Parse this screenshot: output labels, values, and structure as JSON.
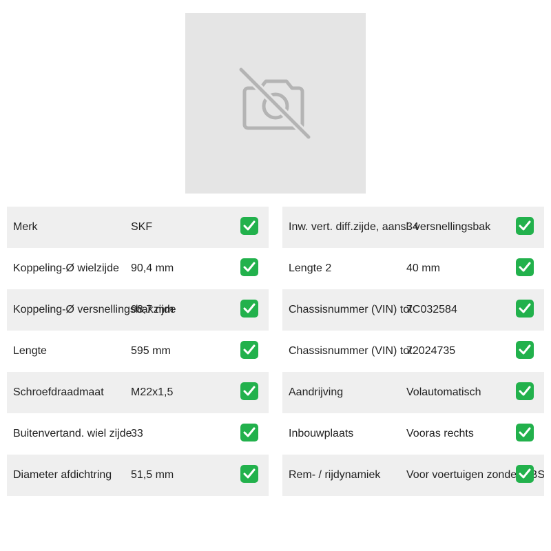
{
  "product_image": {
    "icon": "no-photo-icon",
    "background": "#e5e5e5"
  },
  "check_icon": {
    "name": "check-mark-icon",
    "color": "#22b14c"
  },
  "specs_left": [
    {
      "label": "Merk",
      "value": "SKF"
    },
    {
      "label": "Koppeling-Ø wielzijde",
      "value": "90,4 mm"
    },
    {
      "label": "Koppeling-Ø versnellingsbakzijde",
      "value": "98,7 mm"
    },
    {
      "label": "Lengte",
      "value": "595 mm"
    },
    {
      "label": "Schroefdraadmaat",
      "value": "M22x1,5"
    },
    {
      "label": "Buitenvertand. wiel zijde",
      "value": "33"
    },
    {
      "label": "Diameter afdichtring",
      "value": "51,5 mm"
    }
  ],
  "specs_right": [
    {
      "label": "Inw. vert. diff.zijde, aansl. versnellingsbak",
      "value": "34"
    },
    {
      "label": "Lengte 2",
      "value": "40 mm"
    },
    {
      "label": "Chassisnummer (VIN) tot",
      "value": "7C032584"
    },
    {
      "label": "Chassisnummer (VIN) tot",
      "value": "72024735"
    },
    {
      "label": "Aandrijving",
      "value": "Volautomatisch"
    },
    {
      "label": "Inbouwplaats",
      "value": "Vooras rechts"
    },
    {
      "label": "Rem- / rijdynamiek",
      "value": "Voor voertuigen zonder ABS"
    }
  ]
}
